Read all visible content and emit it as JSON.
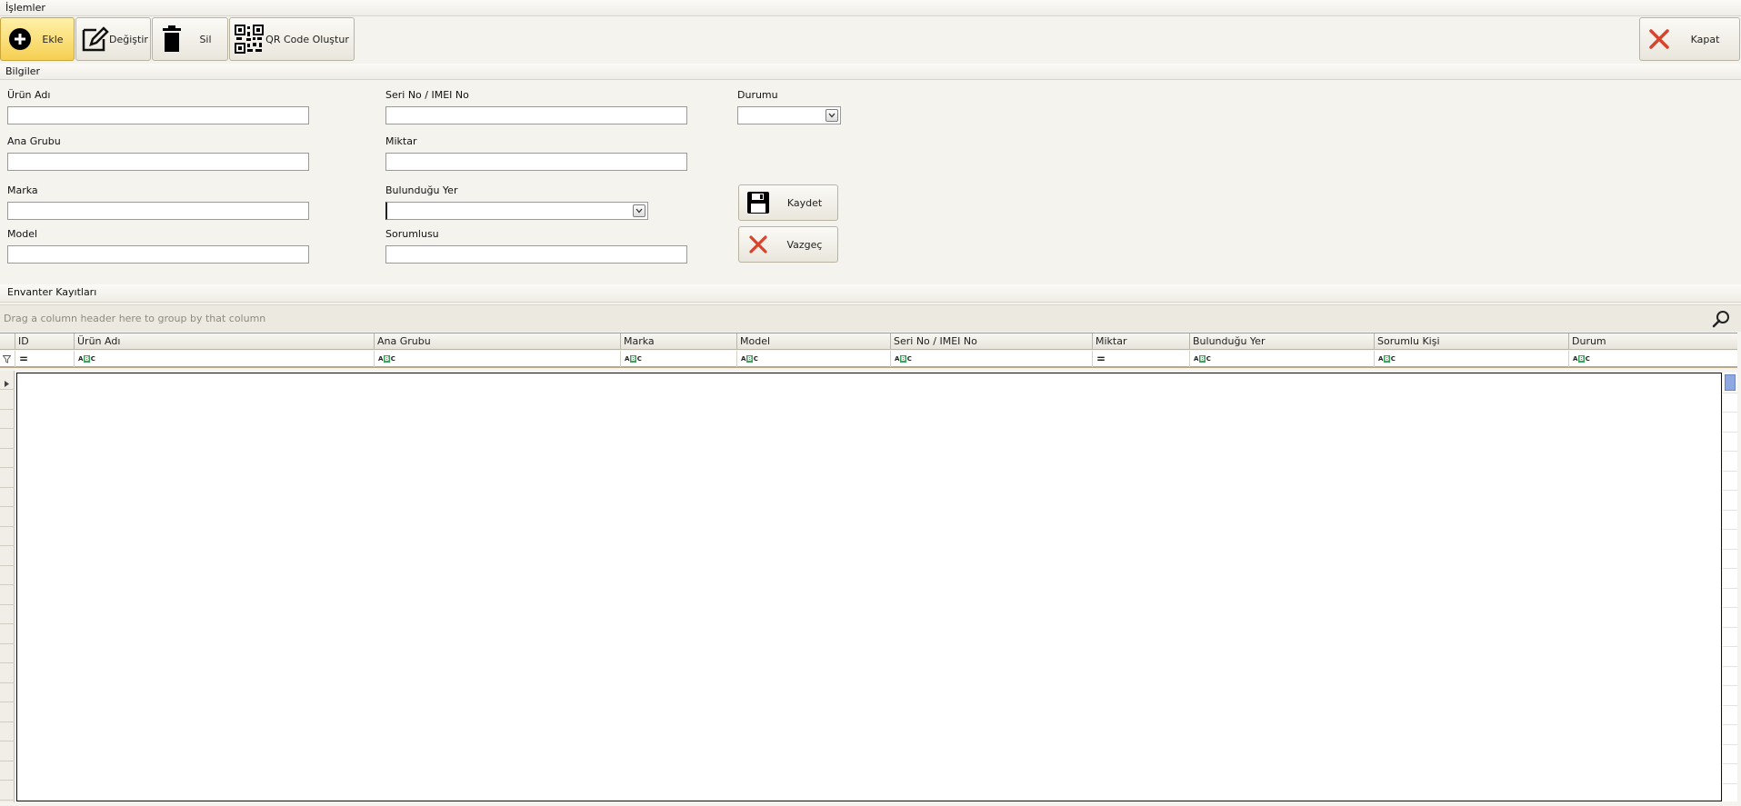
{
  "sections": {
    "operations": "İşlemler",
    "info": "Bilgiler",
    "records": "Envanter Kayıtları"
  },
  "toolbar": {
    "add": "Ekle",
    "edit": "Değiştir",
    "delete": "Sil",
    "qr": "QR Code Oluştur",
    "close": "Kapat"
  },
  "form": {
    "product_name": {
      "label": "Ürün Adı",
      "value": ""
    },
    "serial": {
      "label": "Seri No / IMEI No",
      "value": ""
    },
    "status": {
      "label": "Durumu",
      "value": ""
    },
    "main_group": {
      "label": "Ana Grubu",
      "value": ""
    },
    "quantity": {
      "label": "Miktar",
      "value": ""
    },
    "brand": {
      "label": "Marka",
      "value": ""
    },
    "location": {
      "label": "Bulunduğu Yer",
      "value": ""
    },
    "model": {
      "label": "Model",
      "value": ""
    },
    "responsible": {
      "label": "Sorumlusu",
      "value": ""
    },
    "save": "Kaydet",
    "cancel": "Vazgeç"
  },
  "grid": {
    "group_hint": "Drag a column header here to group by that column",
    "columns": [
      {
        "label": "ID",
        "filter": "eq"
      },
      {
        "label": "Ürün Adı",
        "filter": "abc"
      },
      {
        "label": "Ana Grubu",
        "filter": "abc"
      },
      {
        "label": "Marka",
        "filter": "abc"
      },
      {
        "label": "Model",
        "filter": "abc"
      },
      {
        "label": "Seri No / IMEI No",
        "filter": "abc"
      },
      {
        "label": "Miktar",
        "filter": "eq"
      },
      {
        "label": "Bulunduğu Yer",
        "filter": "abc"
      },
      {
        "label": "Sorumlu Kişi",
        "filter": "abc"
      },
      {
        "label": "Durum",
        "filter": "abc"
      }
    ],
    "rows": []
  },
  "colors": {
    "accent_active": "#f6cf52",
    "close_red": "#d9432c",
    "filter_green": "#39a55a",
    "scroll_thumb": "#8fa8e0"
  }
}
